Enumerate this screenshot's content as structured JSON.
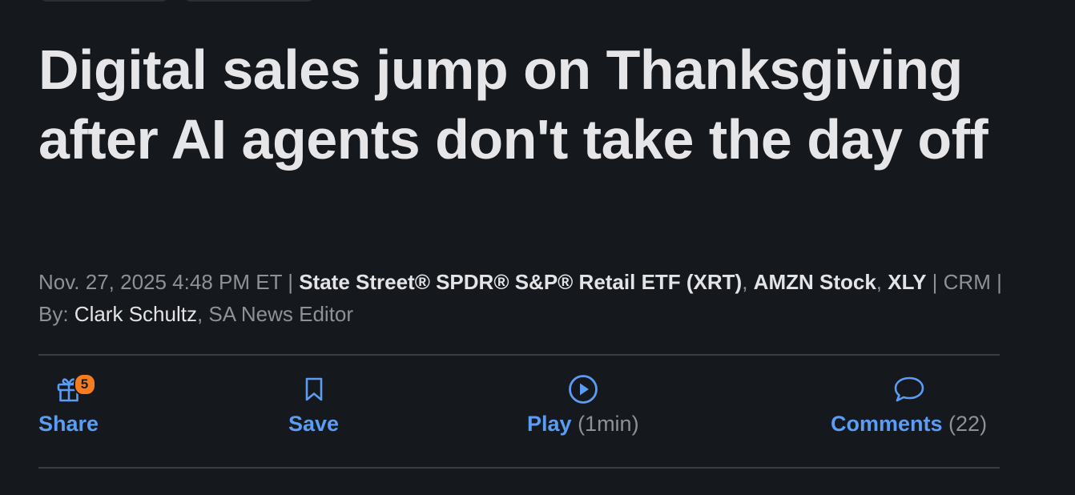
{
  "headline": "Digital sales jump on Thanksgiving after AI agents don't take the day off",
  "meta": {
    "datetime": "Nov. 27, 2025 4:48 PM ET",
    "sep": " | ",
    "ticker1": "State Street® SPDR® S&P® Retail ETF (XRT)",
    "ticker2": "AMZN Stock",
    "ticker3": "XLY",
    "ticker4": "CRM",
    "by_label": "By: ",
    "author": "Clark Schultz",
    "author_role": "SA News Editor"
  },
  "actions": {
    "share": {
      "label": "Share",
      "badge": "5",
      "icon": "gift-icon"
    },
    "save": {
      "label": "Save",
      "icon": "bookmark-icon"
    },
    "play": {
      "label": "Play",
      "extra": "(1min)",
      "icon": "play-circle-icon"
    },
    "comments": {
      "label": "Comments",
      "extra": "(22)",
      "icon": "speech-bubble-icon"
    }
  },
  "colors": {
    "background": "#15181c",
    "accent": "#5b9cf4",
    "badge": "#f57c1f",
    "muted": "#8e9196"
  }
}
